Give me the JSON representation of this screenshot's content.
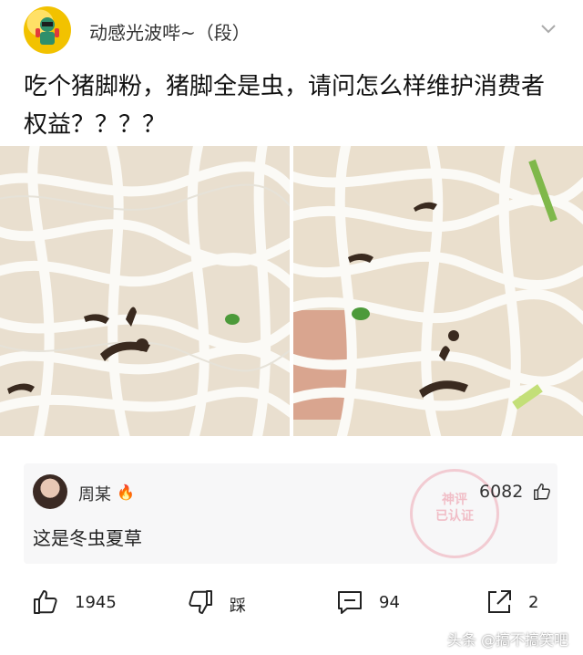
{
  "post": {
    "username": "动感光波哔~（段）",
    "text": "吃个猪脚粉，猪脚全是虫，请问怎么样维护消费者权益？？？？"
  },
  "images": {
    "left_icon": "noodle-photo",
    "right_icon": "noodle-photo"
  },
  "comment": {
    "author": "周某",
    "author_badge": "🔥",
    "text": "这是冬虫夏草",
    "likes": "6082"
  },
  "stamp": {
    "line1": "神评",
    "line2": "已认证"
  },
  "actions": {
    "like_count": "1945",
    "dislike_label": "踩",
    "comment_count": "94",
    "share_count": "2"
  },
  "watermark": "头条 @搞不搞笑吧",
  "colors": {
    "text": "#222222",
    "card": "#f7f7f8",
    "stamp": "#e8788c"
  }
}
